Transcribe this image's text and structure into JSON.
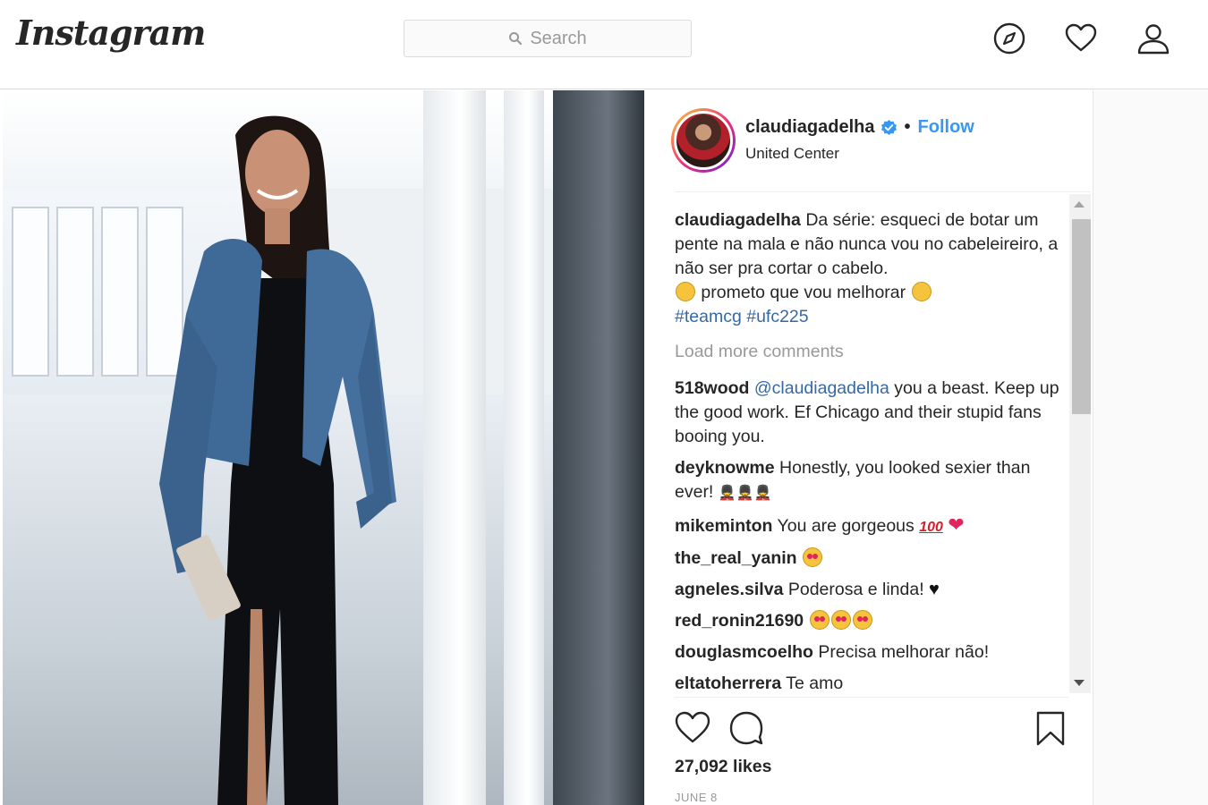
{
  "app": {
    "logo_text": "Instagram",
    "search": {
      "placeholder": "Search"
    },
    "nav_icons": [
      "compass-icon",
      "heart-icon",
      "profile-icon"
    ]
  },
  "post": {
    "author": {
      "username": "claudiagadelha",
      "verified": true,
      "follow_label": "Follow",
      "separator": "•",
      "location": "United Center"
    },
    "caption": {
      "username": "claudiagadelha",
      "text_part1": "Da série: esqueci de botar um pente na mala e não nunca vou no cabeleireiro, a não ser pra cortar o cabelo.",
      "text_part2": "prometo que vou melhorar",
      "hashtags": [
        "#teamcg",
        "#ufc225"
      ]
    },
    "load_more_label": "Load more comments",
    "comments": [
      {
        "username": "518wood",
        "mention": "@claudiagadelha",
        "text": "you a beast. Keep up the good work. Ef Chicago and their stupid fans booing you."
      },
      {
        "username": "deyknowme",
        "text": "Honestly, you looked sexier than ever!",
        "emoji": "💂‍♂💂‍♂💂‍♂"
      },
      {
        "username": "mikeminton",
        "text": "You are gorgeous",
        "emoji": "💯 ❤"
      },
      {
        "username": "the_real_yanin",
        "text": "",
        "emoji": "heart-eyes"
      },
      {
        "username": "agneles.silva",
        "text": "Poderosa e linda!",
        "emoji": "♥"
      },
      {
        "username": "red_ronin21690",
        "text": "",
        "emoji": "heart-eyes x3"
      },
      {
        "username": "douglasmcoelho",
        "text": "Precisa melhorar não!"
      },
      {
        "username": "eltatoherrera",
        "text": "Te amo"
      }
    ],
    "likes_text": "27,092 likes",
    "date_text": "JUNE 8"
  },
  "colors": {
    "link": "#3768a5",
    "follow": "#3897f0",
    "text": "#262626",
    "muted": "#999999",
    "border": "#dbdbdb"
  }
}
